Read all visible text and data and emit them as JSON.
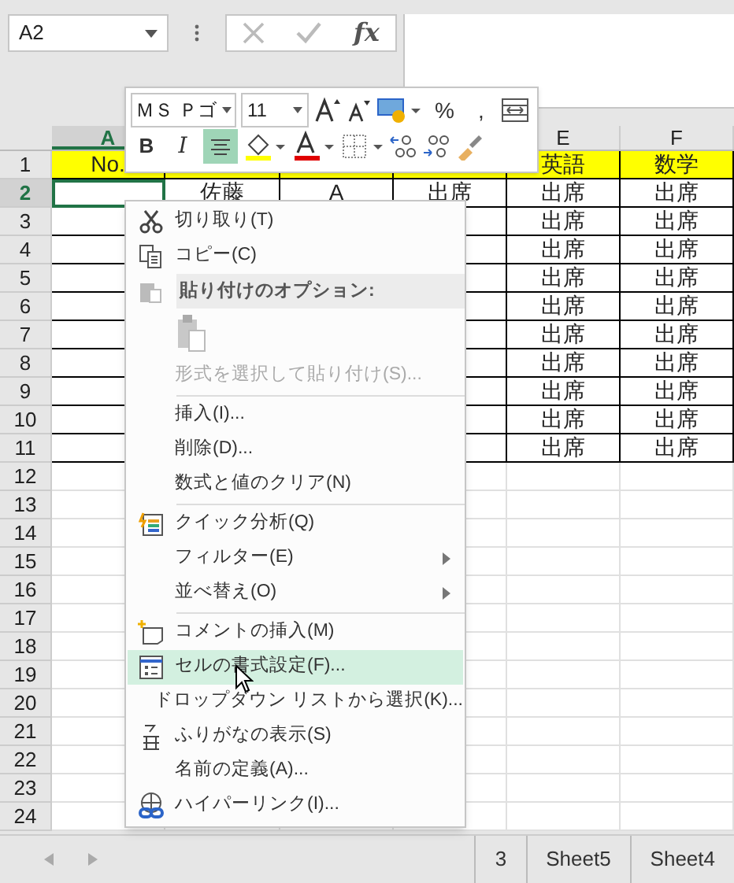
{
  "formula_bar": {
    "name_box": "A2",
    "function_label": "fx"
  },
  "mini_toolbar": {
    "font": "ＭＳ Ｐゴ",
    "size": "11",
    "row1": [
      {
        "kind": "grow"
      },
      {
        "kind": "shrink"
      },
      {
        "kind": "currency"
      },
      {
        "kind": "text",
        "label": "%"
      },
      {
        "kind": "text",
        "label": ","
      },
      {
        "kind": "wrap"
      }
    ],
    "row2": [
      {
        "kind": "bold",
        "label": "B"
      },
      {
        "kind": "italic",
        "label": "I"
      },
      {
        "kind": "align",
        "selected": true
      },
      {
        "kind": "fill"
      },
      {
        "kind": "fontcolor"
      },
      {
        "kind": "borders"
      },
      {
        "kind": "incdec"
      },
      {
        "kind": "decdec"
      },
      {
        "kind": "painter"
      }
    ]
  },
  "sheet": {
    "columns": [
      {
        "label": "A",
        "selected": true
      },
      {
        "label": "E",
        "selected": false
      },
      {
        "label": "F",
        "selected": false
      }
    ],
    "rows": [
      {
        "label": "1",
        "selected": false,
        "kind": "header",
        "cells": [
          "No.",
          null,
          null,
          null,
          "英語",
          "数学"
        ]
      },
      {
        "label": "2",
        "selected": true,
        "kind": "data",
        "cells": [
          null,
          "佐藤",
          "A",
          "出席",
          "出席",
          "出席"
        ]
      },
      {
        "label": "3",
        "selected": false,
        "kind": "data",
        "cells": [
          null,
          null,
          null,
          null,
          "出席",
          "出席"
        ]
      },
      {
        "label": "4",
        "selected": false,
        "kind": "data",
        "cells": [
          null,
          null,
          null,
          null,
          "出席",
          "出席"
        ]
      },
      {
        "label": "5",
        "selected": false,
        "kind": "data",
        "cells": [
          null,
          null,
          null,
          null,
          "出席",
          "出席"
        ]
      },
      {
        "label": "6",
        "selected": false,
        "kind": "data",
        "cells": [
          null,
          null,
          null,
          null,
          "出席",
          "出席"
        ]
      },
      {
        "label": "7",
        "selected": false,
        "kind": "data",
        "cells": [
          null,
          null,
          null,
          null,
          "出席",
          "出席"
        ]
      },
      {
        "label": "8",
        "selected": false,
        "kind": "data",
        "cells": [
          null,
          null,
          null,
          null,
          "出席",
          "出席"
        ]
      },
      {
        "label": "9",
        "selected": false,
        "kind": "data",
        "cells": [
          null,
          null,
          null,
          null,
          "出席",
          "出席"
        ]
      },
      {
        "label": "10",
        "selected": false,
        "kind": "data",
        "cells": [
          null,
          null,
          null,
          null,
          "出席",
          "出席"
        ]
      },
      {
        "label": "11",
        "selected": false,
        "kind": "data",
        "cells": [
          null,
          null,
          null,
          null,
          "出席",
          "出席"
        ]
      },
      {
        "label": "12",
        "selected": false,
        "kind": "empty"
      },
      {
        "label": "13",
        "selected": false,
        "kind": "empty"
      },
      {
        "label": "14",
        "selected": false,
        "kind": "empty"
      },
      {
        "label": "15",
        "selected": false,
        "kind": "empty"
      },
      {
        "label": "16",
        "selected": false,
        "kind": "empty"
      },
      {
        "label": "17",
        "selected": false,
        "kind": "empty"
      },
      {
        "label": "18",
        "selected": false,
        "kind": "empty"
      },
      {
        "label": "19",
        "selected": false,
        "kind": "empty"
      },
      {
        "label": "20",
        "selected": false,
        "kind": "empty"
      },
      {
        "label": "21",
        "selected": false,
        "kind": "empty"
      },
      {
        "label": "22",
        "selected": false,
        "kind": "empty"
      },
      {
        "label": "23",
        "selected": false,
        "kind": "empty"
      },
      {
        "label": "24",
        "selected": false,
        "kind": "empty"
      }
    ]
  },
  "sheet_tabs": [
    {
      "label": "3"
    },
    {
      "label": "Sheet5"
    },
    {
      "label": "Sheet4"
    }
  ],
  "context_menu": [
    {
      "kind": "cut",
      "label": "切り取り(T)",
      "disabled": false,
      "selected": false,
      "submenu": false
    },
    {
      "kind": "copy",
      "label": "コピー(C)",
      "disabled": false,
      "selected": false,
      "submenu": false
    },
    {
      "kind": "paste_header",
      "label": "貼り付けのオプション:"
    },
    {
      "kind": "paste_options"
    },
    {
      "kind": "plain",
      "label": "形式を選択して貼り付け(S)...",
      "disabled": true,
      "selected": false,
      "submenu": false
    },
    {
      "kind": "separator"
    },
    {
      "kind": "plain",
      "label": "挿入(I)...",
      "disabled": false,
      "selected": false,
      "submenu": false
    },
    {
      "kind": "plain",
      "label": "削除(D)...",
      "disabled": false,
      "selected": false,
      "submenu": false
    },
    {
      "kind": "plain",
      "label": "数式と値のクリア(N)",
      "disabled": false,
      "selected": false,
      "submenu": false
    },
    {
      "kind": "separator"
    },
    {
      "kind": "quick",
      "label": "クイック分析(Q)",
      "disabled": false,
      "selected": false,
      "submenu": false
    },
    {
      "kind": "plain",
      "label": "フィルター(E)",
      "disabled": false,
      "selected": false,
      "submenu": true
    },
    {
      "kind": "plain",
      "label": "並べ替え(O)",
      "disabled": false,
      "selected": false,
      "submenu": true
    },
    {
      "kind": "separator"
    },
    {
      "kind": "comment",
      "label": "コメントの挿入(M)",
      "disabled": false,
      "selected": false,
      "submenu": false
    },
    {
      "kind": "format",
      "label": "セルの書式設定(F)...",
      "disabled": false,
      "selected": true,
      "submenu": false
    },
    {
      "kind": "plain",
      "label": "ドロップダウン リストから選択(K)...",
      "disabled": false,
      "selected": false,
      "submenu": false
    },
    {
      "kind": "furigana",
      "label": "ふりがなの表示(S)",
      "disabled": false,
      "selected": false,
      "submenu": false
    },
    {
      "kind": "plain",
      "label": "名前の定義(A)...",
      "disabled": false,
      "selected": false,
      "submenu": false
    },
    {
      "kind": "link",
      "label": "ハイパーリンク(I)...",
      "disabled": false,
      "selected": false,
      "submenu": false
    }
  ]
}
